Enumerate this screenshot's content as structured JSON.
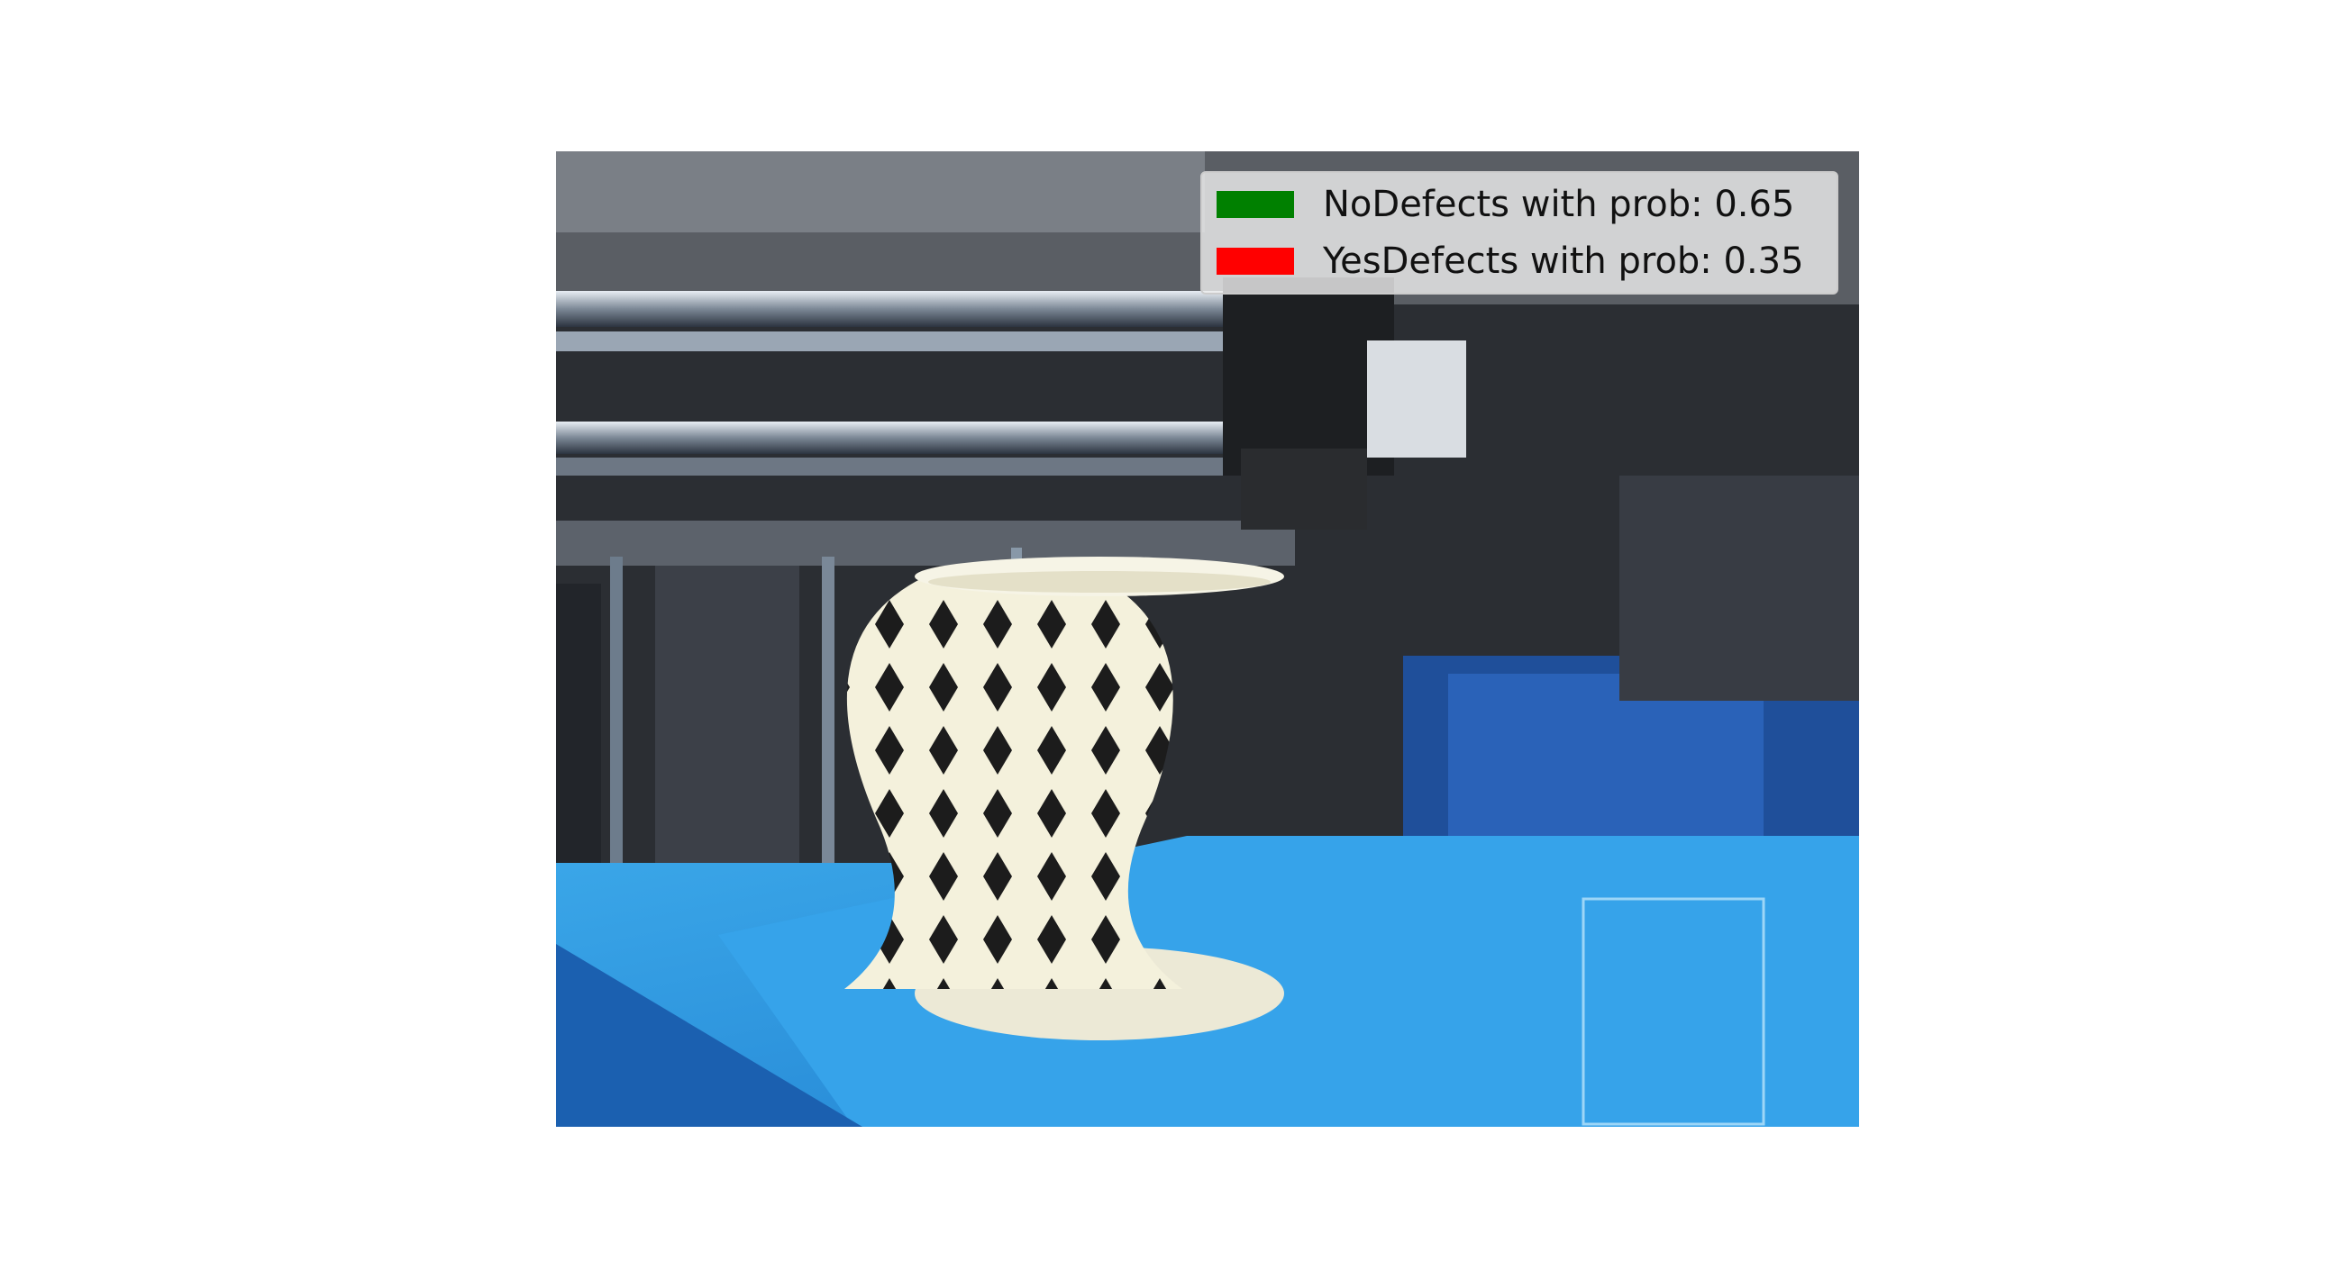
{
  "image": {
    "subject": "3d-printed-lattice-vase-on-printer-bed",
    "icon": "photo-icon"
  },
  "legend": {
    "items": [
      {
        "label": "NoDefects with prob: 0.65",
        "color": "#008000",
        "class": "NoDefects",
        "prob": 0.65
      },
      {
        "label": "YesDefects with prob: 0.35",
        "color": "#ff0000",
        "class": "YesDefects",
        "prob": 0.35
      }
    ]
  }
}
